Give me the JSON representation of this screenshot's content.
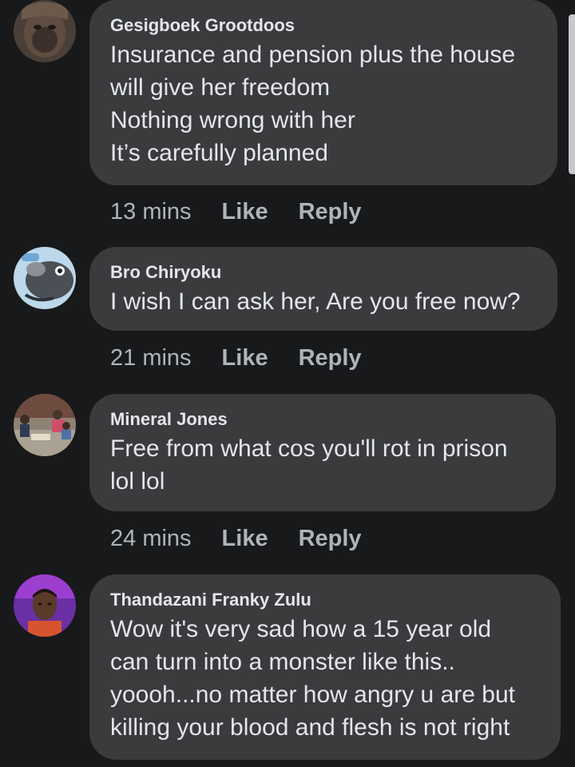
{
  "comments": [
    {
      "author": "Gesigboek Grootdoos",
      "lines": [
        "Insurance and pension plus the house",
        "will give her freedom",
        "Nothing wrong with her",
        "It’s carefully planned"
      ],
      "time": "13 mins",
      "like_label": "Like",
      "reply_label": "Reply",
      "avatar_icon": "ape-face-avatar"
    },
    {
      "author": "Bro Chiryoku",
      "lines": [
        "I wish I can ask her, Are you free now?"
      ],
      "time": "21 mins",
      "like_label": "Like",
      "reply_label": "Reply",
      "avatar_icon": "cartoon-creature-avatar"
    },
    {
      "author": "Mineral Jones",
      "lines": [
        "Free from what cos you'll rot in prison",
        "lol lol"
      ],
      "time": "24 mins",
      "like_label": "Like",
      "reply_label": "Reply",
      "avatar_icon": "group-photo-avatar"
    },
    {
      "author": "Thandazani Franky Zulu",
      "lines": [
        "Wow it's very sad how a 15 year old",
        "can turn into a monster like this..",
        "yoooh...no matter how angry u are but",
        "killing your blood and flesh is not right"
      ],
      "avatar_icon": "person-portrait-avatar"
    }
  ],
  "colors": {
    "background": "#18191a",
    "bubble": "#3a3b3c",
    "text": "#e4e6eb",
    "secondary_text": "#b0b3b8"
  }
}
